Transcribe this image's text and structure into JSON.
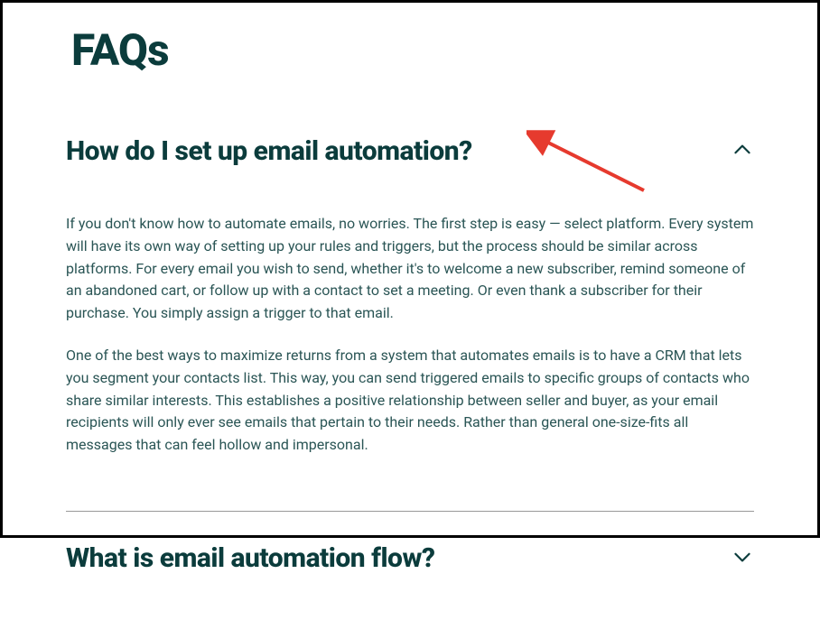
{
  "pageTitle": "FAQs",
  "faqs": [
    {
      "question": "How do I set up email automation?",
      "expanded": true,
      "paragraphs": [
        "If you don't know how to automate emails, no worries. The first step is easy — select platform. Every system will have its own way of setting up your rules and triggers, but the process should be similar across platforms. For every email you wish to send, whether it's to welcome a new subscriber, remind someone of an abandoned cart, or follow up with a contact to set a meeting. Or even thank a subscriber for their purchase. You simply assign a trigger to that email.",
        "One of the best ways to maximize returns from a system that automates emails is to have a CRM that lets you segment your contacts list. This way, you can send triggered emails to specific groups of contacts who share similar interests. This establishes a positive relationship between seller and buyer, as your email recipients will only ever see emails that pertain to their needs. Rather than general one-size-fits all messages that can feel hollow and impersonal."
      ]
    },
    {
      "question": "What is email automation flow?",
      "expanded": false,
      "paragraphs": []
    }
  ],
  "colors": {
    "heading": "#0b3c3c",
    "body": "#2a5555",
    "annotation": "#e63a2e"
  }
}
